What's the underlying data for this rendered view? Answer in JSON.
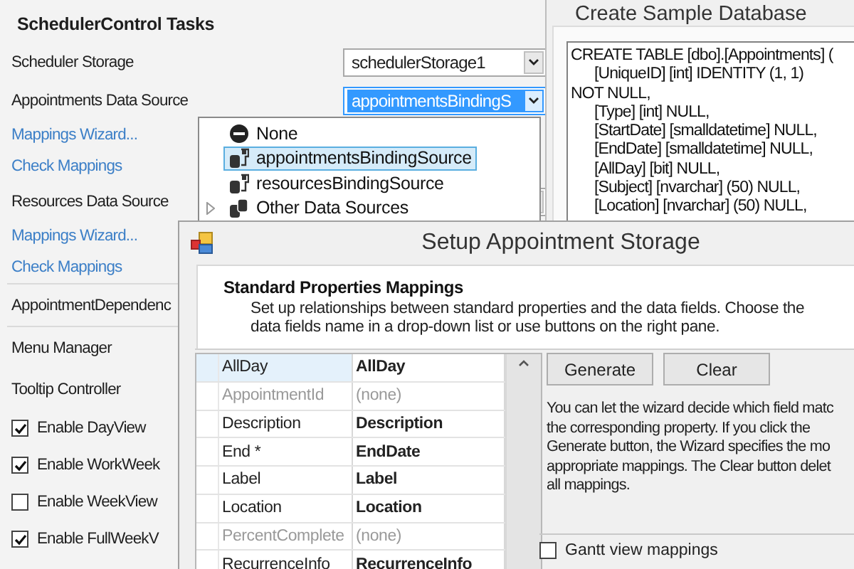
{
  "tasks_panel": {
    "title": "SchedulerControl Tasks",
    "groups": [
      {
        "items": [
          {
            "kind": "combo",
            "label": "Scheduler Storage",
            "value": "schedulerStorage1",
            "focused": false
          },
          {
            "kind": "combo",
            "label": "Appointments Data Source",
            "value": "appointmentsBindingS",
            "focused": true
          },
          {
            "kind": "link",
            "label": "Mappings Wizard..."
          },
          {
            "kind": "link",
            "label": "Check Mappings"
          },
          {
            "kind": "combo",
            "label": "Resources Data Source",
            "focused": false
          },
          {
            "kind": "link",
            "label": "Mappings Wizard..."
          },
          {
            "kind": "link",
            "label": "Check Mappings"
          }
        ]
      },
      {
        "items": [
          {
            "kind": "item",
            "label": "AppointmentDependenc"
          }
        ]
      },
      {
        "items": [
          {
            "kind": "item",
            "label": "Menu Manager"
          },
          {
            "kind": "item",
            "label": "Tooltip Controller"
          },
          {
            "kind": "checkbox",
            "label": "Enable DayView",
            "checked": true
          },
          {
            "kind": "checkbox",
            "label": "Enable WorkWeek",
            "checked": true
          },
          {
            "kind": "checkbox",
            "label": "Enable WeekView",
            "checked": false
          },
          {
            "kind": "checkbox",
            "label": "Enable FullWeekV",
            "checked": true
          }
        ]
      }
    ]
  },
  "data_source_dropdown": {
    "items": [
      {
        "kind": "none",
        "label": "None",
        "selected": false,
        "expandable": false
      },
      {
        "kind": "source",
        "label": "appointmentsBindingSource",
        "selected": true,
        "expandable": false
      },
      {
        "kind": "source",
        "label": "resourcesBindingSource",
        "selected": false,
        "expandable": false
      },
      {
        "kind": "group",
        "label": "Other Data Sources",
        "selected": false,
        "expandable": true
      }
    ]
  },
  "database_window": {
    "title": "Create Sample Database",
    "sql_lines": [
      "CREATE TABLE [dbo].[Appointments] (",
      "\t[UniqueID] [int] IDENTITY (1, 1)",
      "NOT NULL,",
      "\t[Type] [int] NULL,",
      "\t[StartDate] [smalldatetime] NULL,",
      "\t[EndDate] [smalldatetime] NULL,",
      "\t[AllDay] [bit] NULL,",
      "\t[Subject] [nvarchar] (50) NULL,",
      "\t[Location] [nvarchar] (50) NULL,"
    ]
  },
  "setup_dialog": {
    "title": "Setup Appointment Storage",
    "section_title": "Standard Properties Mappings",
    "description_lines": [
      "Set up relationships between standard properties and the data fields. Choose the",
      "data fields name in a drop-down list or use buttons on the right pane."
    ],
    "mappings": [
      {
        "property": "AllDay",
        "field": "AllDay",
        "mapped": true,
        "selected": true
      },
      {
        "property": "AppointmentId",
        "field": "(none)",
        "mapped": false,
        "selected": false
      },
      {
        "property": "Description",
        "field": "Description",
        "mapped": true,
        "selected": false
      },
      {
        "property": "End *",
        "field": "EndDate",
        "mapped": true,
        "selected": false
      },
      {
        "property": "Label",
        "field": "Label",
        "mapped": true,
        "selected": false
      },
      {
        "property": "Location",
        "field": "Location",
        "mapped": true,
        "selected": false
      },
      {
        "property": "PercentComplete",
        "field": "(none)",
        "mapped": false,
        "selected": false
      },
      {
        "property": "RecurrenceInfo",
        "field": "RecurrenceInfo",
        "mapped": true,
        "selected": false
      }
    ],
    "buttons": [
      "Generate",
      "Clear"
    ],
    "help_lines": [
      "You can let the wizard decide which field matc",
      "the corresponding property. If you click the",
      "Generate button, the Wizard specifies the mo",
      "appropriate mappings. The Clear button delet",
      "all mappings."
    ],
    "gantt_checkbox": {
      "label": "Gantt view mappings",
      "checked": false
    }
  }
}
